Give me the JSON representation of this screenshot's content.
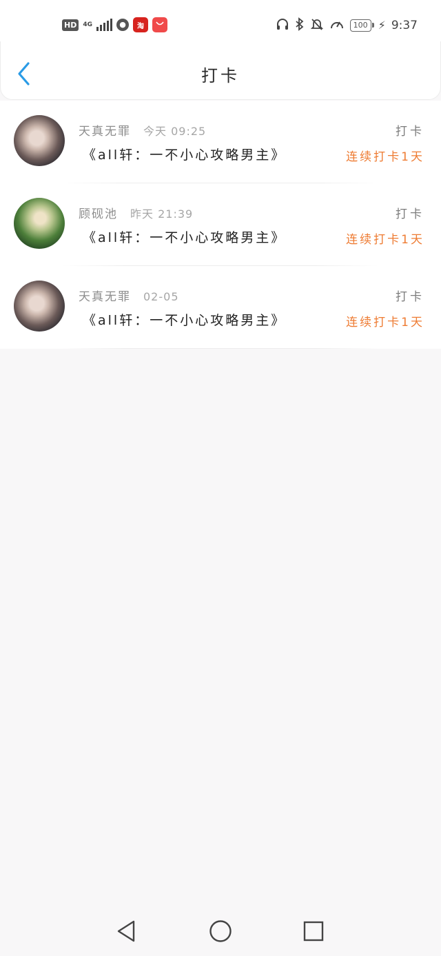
{
  "status_bar": {
    "hd": "HD",
    "network": "4G",
    "battery": "100",
    "time": "9:37",
    "icons": [
      "hd-icon",
      "signal-icon",
      "globe-icon",
      "taobao-icon",
      "shop-icon",
      "headphones-icon",
      "bluetooth-icon",
      "mute-bell-icon",
      "speed-icon",
      "battery-icon",
      "charging-icon"
    ],
    "taobao_label": "淘"
  },
  "header": {
    "title": "打卡",
    "back_icon": "chevron-left-icon",
    "accent": "#2a9be6"
  },
  "list": [
    {
      "user": "天真无罪",
      "time": "今天 09:25",
      "book": "《all轩：一不小心攻略男主》",
      "type": "打卡",
      "streak": "连续打卡1天"
    },
    {
      "user": "顾砚池",
      "time": "昨天 21:39",
      "book": "《all轩：一不小心攻略男主》",
      "type": "打卡",
      "streak": "连续打卡1天"
    },
    {
      "user": "天真无罪",
      "time": "02-05",
      "book": "《all轩：一不小心攻略男主》",
      "type": "打卡",
      "streak": "连续打卡1天"
    }
  ],
  "colors": {
    "streak": "#ee7b32",
    "background": "#f8f7f8"
  },
  "nav": {
    "icons": [
      "back-triangle-icon",
      "home-circle-icon",
      "recents-square-icon"
    ]
  }
}
